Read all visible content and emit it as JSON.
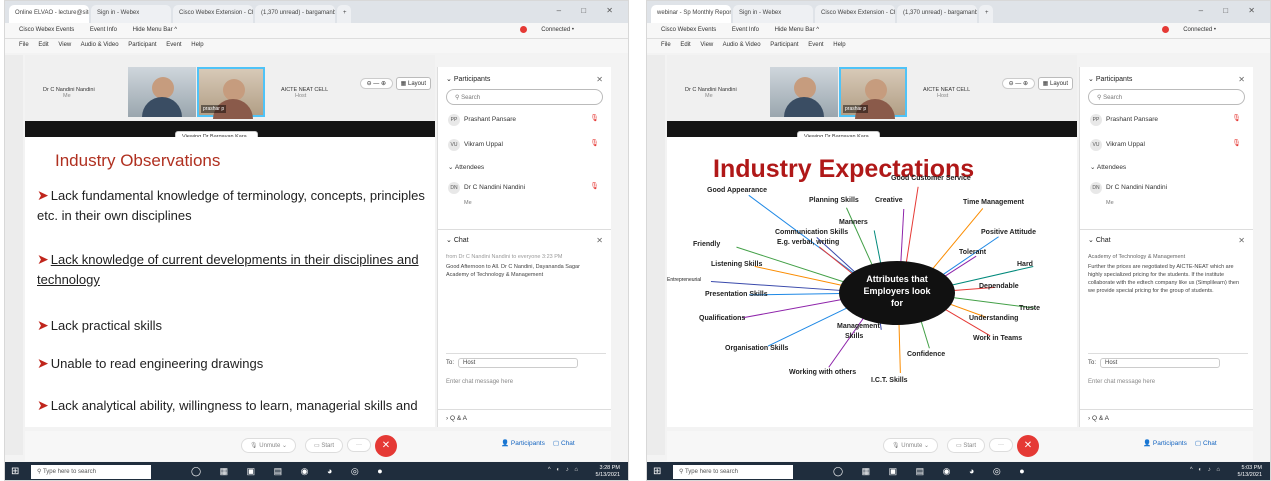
{
  "screens": [
    {
      "tabs": [
        "Online ELVAO - lecture@sitoni",
        "Sign in - Webex",
        "Cisco Webex Extension - Chrome",
        "(1,370 unread) - bargamanbvi4",
        "+"
      ],
      "webex_bar": [
        "Cisco Webex Events",
        "Event Info",
        "Hide Menu Bar ^"
      ],
      "connected": "Connected •",
      "menu": [
        "File",
        "Edit",
        "View",
        "Audio & Video",
        "Participant",
        "Event",
        "Help"
      ],
      "host_label": "Dr C Nandini Nandini",
      "host_sub": "Me",
      "video_name": "prashar p",
      "aicte_label": "AICTE NEAT CELL",
      "aicte_sub": "Host",
      "layout": "Layout",
      "viewing": "Viewing Dr Bargavan Kara...",
      "slide_title": "Industry Observations",
      "items": [
        "Lack fundamental knowledge of terminology, concepts, principles etc. in their own disciplines",
        "Lack knowledge of current developments in their disciplines and technology",
        "Lack practical skills",
        "Unable to read engineering drawings",
        "Lack analytical ability, willingness to learn, managerial skills and"
      ],
      "panel": {
        "participants": "Participants",
        "search": "Search",
        "p1_initials": "PP",
        "p1": "Prashant Pansare",
        "p2_initials": "VU",
        "p2": "Vikram Uppal",
        "attendees": "Attendees",
        "a1_initials": "DN",
        "a1": "Dr C Nandini Nandini",
        "a1_sub": "Me",
        "chat": "Chat",
        "chat_from": "from Dr C Nandini Nandini to everyone 3:23 PM",
        "chat_msg": "Good Afternoon to All. Dr C Nandini, Dayananda Sagar Academy of Technology & Management",
        "to_label": "To:",
        "to_value": "Host",
        "input_placeholder": "Enter chat message here",
        "qa": "Q & A"
      },
      "bottom": {
        "unmute": "Unmute",
        "start_video": "Start",
        "participants": "Participants",
        "chat": "Chat"
      },
      "taskbar": {
        "search": "Type here to search",
        "time": "3:28 PM",
        "date": "5/13/2021"
      }
    },
    {
      "tabs": [
        "webinar - Sp Monthly Report",
        "Sign in - Webex",
        "Cisco Webex Extension - Chrome",
        "(1,370 unread) - bargamanbvi4",
        "+"
      ],
      "webex_bar": [
        "Cisco Webex Events",
        "Event Info",
        "Hide Menu Bar ^"
      ],
      "connected": "Connected •",
      "menu": [
        "File",
        "Edit",
        "View",
        "Audio & Video",
        "Participant",
        "Event",
        "Help"
      ],
      "host_label": "Dr C Nandini Nandini",
      "host_sub": "Me",
      "video_name": "prashar p",
      "aicte_label": "AICTE NEAT CELL",
      "aicte_sub": "Host",
      "layout": "Layout",
      "viewing": "Viewing Dr Bargavan Kara...",
      "slide_title": "Industry Expectations",
      "center": [
        "Attributes that",
        "Employers look",
        "for"
      ],
      "words": [
        "Good Customer Service",
        "Good Appearance",
        "Planning Skills",
        "Creative",
        "Time Management",
        "Manners",
        "Communication Skills",
        "E.g. verbal, writing",
        "Positive Attitude",
        "Friendly",
        "Tolerant",
        "Listening Skills",
        "Hard",
        "Entrepreneurial",
        "Dependable",
        "Presentation Skills",
        "Truste",
        "Qualifications",
        "Understanding",
        "Management",
        "Skills",
        "Work in Teams",
        "Organisation Skills",
        "Confidence",
        "Working with others",
        "I.C.T. Skills"
      ],
      "panel": {
        "participants": "Participants",
        "search": "Search",
        "p1_initials": "PP",
        "p1": "Prashant Pansare",
        "p2_initials": "VU",
        "p2": "Vikram Uppal",
        "attendees": "Attendees",
        "a1_initials": "DN",
        "a1": "Dr C Nandini Nandini",
        "a1_sub": "Me",
        "chat": "Chat",
        "chat_from": "Academy of Technology & Management",
        "chat_msg": "Further the prices are negotiated by AICTE-NEAT which are highly specialized pricing for the students. If the institute collaborate with the edtech company like us (Simplilearn) then we provide special pricing for the group of students.",
        "to_label": "To:",
        "to_value": "Host",
        "input_placeholder": "Enter chat message here",
        "qa": "Q & A"
      },
      "bottom": {
        "unmute": "Unmute",
        "start_video": "Start",
        "participants": "Participants",
        "chat": "Chat"
      },
      "taskbar": {
        "search": "Type here to search",
        "time": "5:03 PM",
        "date": "5/13/2021"
      }
    }
  ]
}
